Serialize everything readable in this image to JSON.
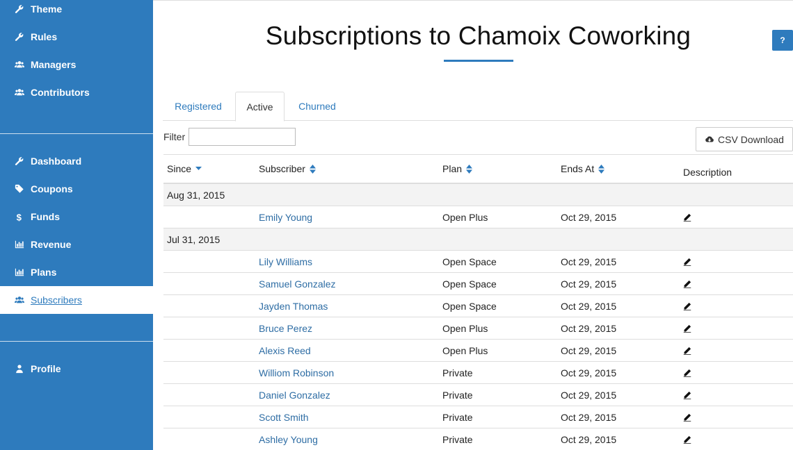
{
  "sidebar": {
    "top_items": [
      {
        "label": "Theme",
        "icon": "wrench-icon"
      },
      {
        "label": "Rules",
        "icon": "wrench-icon"
      },
      {
        "label": "Managers",
        "icon": "users-icon"
      },
      {
        "label": "Contributors",
        "icon": "users-icon"
      }
    ],
    "mid_items": [
      {
        "label": "Dashboard",
        "icon": "wrench-icon"
      },
      {
        "label": "Coupons",
        "icon": "tag-icon"
      },
      {
        "label": "Funds",
        "icon": "dollar-icon"
      },
      {
        "label": "Revenue",
        "icon": "bar-chart-icon"
      },
      {
        "label": "Plans",
        "icon": "bar-chart-icon"
      },
      {
        "label": "Subscribers",
        "icon": "users-icon",
        "active": true
      }
    ],
    "bottom_items": [
      {
        "label": "Profile",
        "icon": "user-icon"
      }
    ]
  },
  "header": {
    "title": "Subscriptions to Chamoix Coworking",
    "help_label": "?"
  },
  "tabs": [
    {
      "label": "Registered"
    },
    {
      "label": "Active",
      "active": true
    },
    {
      "label": "Churned"
    }
  ],
  "filter": {
    "label": "Filter",
    "value": ""
  },
  "csv_button": {
    "label": "CSV Download"
  },
  "table": {
    "columns": [
      {
        "label": "Since",
        "sort": "desc"
      },
      {
        "label": "Subscriber",
        "sort": "both"
      },
      {
        "label": "Plan",
        "sort": "both"
      },
      {
        "label": "Ends At",
        "sort": "both"
      },
      {
        "label": "Description",
        "sort": "none"
      }
    ],
    "groups": [
      {
        "since": "Aug 31, 2015",
        "rows": [
          {
            "subscriber": "Emily Young",
            "plan": "Open Plus",
            "ends_at": "Oct 29, 2015"
          }
        ]
      },
      {
        "since": "Jul 31, 2015",
        "rows": [
          {
            "subscriber": "Lily Williams",
            "plan": "Open Space",
            "ends_at": "Oct 29, 2015"
          },
          {
            "subscriber": "Samuel Gonzalez",
            "plan": "Open Space",
            "ends_at": "Oct 29, 2015"
          },
          {
            "subscriber": "Jayden Thomas",
            "plan": "Open Space",
            "ends_at": "Oct 29, 2015"
          },
          {
            "subscriber": "Bruce Perez",
            "plan": "Open Plus",
            "ends_at": "Oct 29, 2015"
          },
          {
            "subscriber": "Alexis Reed",
            "plan": "Open Plus",
            "ends_at": "Oct 29, 2015"
          },
          {
            "subscriber": "Williom Robinson",
            "plan": "Private",
            "ends_at": "Oct 29, 2015"
          },
          {
            "subscriber": "Daniel Gonzalez",
            "plan": "Private",
            "ends_at": "Oct 29, 2015"
          },
          {
            "subscriber": "Scott Smith",
            "plan": "Private",
            "ends_at": "Oct 29, 2015"
          },
          {
            "subscriber": "Ashley Young",
            "plan": "Private",
            "ends_at": "Oct 29, 2015"
          }
        ]
      }
    ]
  },
  "colors": {
    "brand": "#2e7bbd",
    "link": "#2e6da4"
  }
}
